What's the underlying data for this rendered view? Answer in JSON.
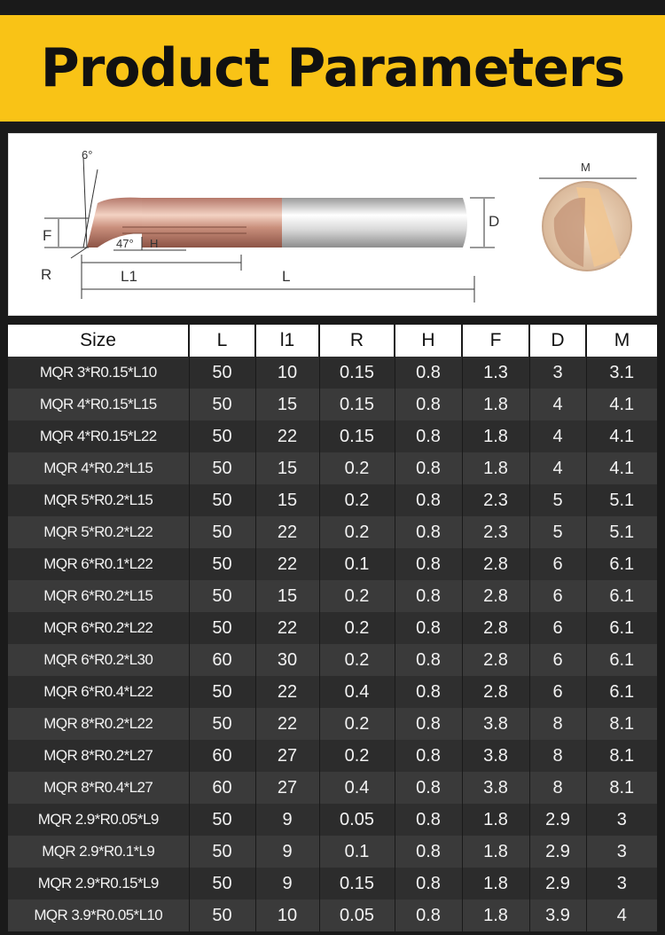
{
  "banner": {
    "title": "Product Parameters"
  },
  "diagram": {
    "angle_top": "6°",
    "angle_tip": "47°",
    "label_H": "H",
    "label_F": "F",
    "label_R": "R",
    "label_L1": "L1",
    "label_L": "L",
    "label_D": "D",
    "label_M": "M"
  },
  "table": {
    "headers": [
      "Size",
      "L",
      "l1",
      "R",
      "H",
      "F",
      "D",
      "M"
    ],
    "rows": [
      [
        "MQR 3*R0.15*L10",
        "50",
        "10",
        "0.15",
        "0.8",
        "1.3",
        "3",
        "3.1"
      ],
      [
        "MQR 4*R0.15*L15",
        "50",
        "15",
        "0.15",
        "0.8",
        "1.8",
        "4",
        "4.1"
      ],
      [
        "MQR 4*R0.15*L22",
        "50",
        "22",
        "0.15",
        "0.8",
        "1.8",
        "4",
        "4.1"
      ],
      [
        "MQR 4*R0.2*L15",
        "50",
        "15",
        "0.2",
        "0.8",
        "1.8",
        "4",
        "4.1"
      ],
      [
        "MQR 5*R0.2*L15",
        "50",
        "15",
        "0.2",
        "0.8",
        "2.3",
        "5",
        "5.1"
      ],
      [
        "MQR 5*R0.2*L22",
        "50",
        "22",
        "0.2",
        "0.8",
        "2.3",
        "5",
        "5.1"
      ],
      [
        "MQR 6*R0.1*L22",
        "50",
        "22",
        "0.1",
        "0.8",
        "2.8",
        "6",
        "6.1"
      ],
      [
        "MQR 6*R0.2*L15",
        "50",
        "15",
        "0.2",
        "0.8",
        "2.8",
        "6",
        "6.1"
      ],
      [
        "MQR 6*R0.2*L22",
        "50",
        "22",
        "0.2",
        "0.8",
        "2.8",
        "6",
        "6.1"
      ],
      [
        "MQR 6*R0.2*L30",
        "60",
        "30",
        "0.2",
        "0.8",
        "2.8",
        "6",
        "6.1"
      ],
      [
        "MQR 6*R0.4*L22",
        "50",
        "22",
        "0.4",
        "0.8",
        "2.8",
        "6",
        "6.1"
      ],
      [
        "MQR 8*R0.2*L22",
        "50",
        "22",
        "0.2",
        "0.8",
        "3.8",
        "8",
        "8.1"
      ],
      [
        "MQR 8*R0.2*L27",
        "60",
        "27",
        "0.2",
        "0.8",
        "3.8",
        "8",
        "8.1"
      ],
      [
        "MQR 8*R0.4*L27",
        "60",
        "27",
        "0.4",
        "0.8",
        "3.8",
        "8",
        "8.1"
      ],
      [
        "MQR 2.9*R0.05*L9",
        "50",
        "9",
        "0.05",
        "0.8",
        "1.8",
        "2.9",
        "3"
      ],
      [
        "MQR 2.9*R0.1*L9",
        "50",
        "9",
        "0.1",
        "0.8",
        "1.8",
        "2.9",
        "3"
      ],
      [
        "MQR 2.9*R0.15*L9",
        "50",
        "9",
        "0.15",
        "0.8",
        "1.8",
        "2.9",
        "3"
      ],
      [
        "MQR 3.9*R0.05*L10",
        "50",
        "10",
        "0.05",
        "0.8",
        "1.8",
        "3.9",
        "4"
      ]
    ]
  }
}
